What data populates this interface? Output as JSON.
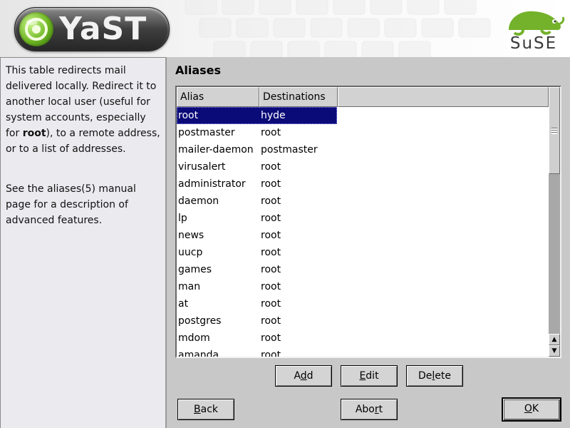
{
  "header": {
    "app_logo": "YaST",
    "vendor_logo": "SuSE"
  },
  "help": {
    "p1_before": "This table redirects mail delivered locally. Redirect it to another local user (useful for system accounts, especially for ",
    "p1_bold": "root",
    "p1_after": "), to a remote address, or to a list of addresses.",
    "p2": "See the aliases(5) manual page for a description of advanced features."
  },
  "main": {
    "title": "Aliases",
    "table": {
      "columns": [
        "Alias",
        "Destinations"
      ],
      "selected_index": 0,
      "rows": [
        {
          "alias": "root",
          "destination": "hyde"
        },
        {
          "alias": "postmaster",
          "destination": "root"
        },
        {
          "alias": "mailer-daemon",
          "destination": "postmaster"
        },
        {
          "alias": "virusalert",
          "destination": "root"
        },
        {
          "alias": "administrator",
          "destination": "root"
        },
        {
          "alias": "daemon",
          "destination": "root"
        },
        {
          "alias": "lp",
          "destination": "root"
        },
        {
          "alias": "news",
          "destination": "root"
        },
        {
          "alias": "uucp",
          "destination": "root"
        },
        {
          "alias": "games",
          "destination": "root"
        },
        {
          "alias": "man",
          "destination": "root"
        },
        {
          "alias": "at",
          "destination": "root"
        },
        {
          "alias": "postgres",
          "destination": "root"
        },
        {
          "alias": "mdom",
          "destination": "root"
        },
        {
          "alias": "amanda",
          "destination": "root"
        }
      ]
    },
    "buttons": {
      "add": {
        "pre": "A",
        "mn": "d",
        "post": "d"
      },
      "edit": {
        "pre": "",
        "mn": "E",
        "post": "dit"
      },
      "delete": {
        "pre": "De",
        "mn": "l",
        "post": "ete"
      }
    }
  },
  "footer": {
    "back": {
      "pre": "",
      "mn": "B",
      "post": "ack"
    },
    "abort": {
      "pre": "Abo",
      "mn": "r",
      "post": "t"
    },
    "ok": {
      "pre": "",
      "mn": "O",
      "post": "K"
    }
  },
  "colors": {
    "selection": "#0a0a78",
    "window_bg": "#c8c8c8",
    "help_bg": "#ebebef",
    "logo_green": "#6fb523"
  }
}
